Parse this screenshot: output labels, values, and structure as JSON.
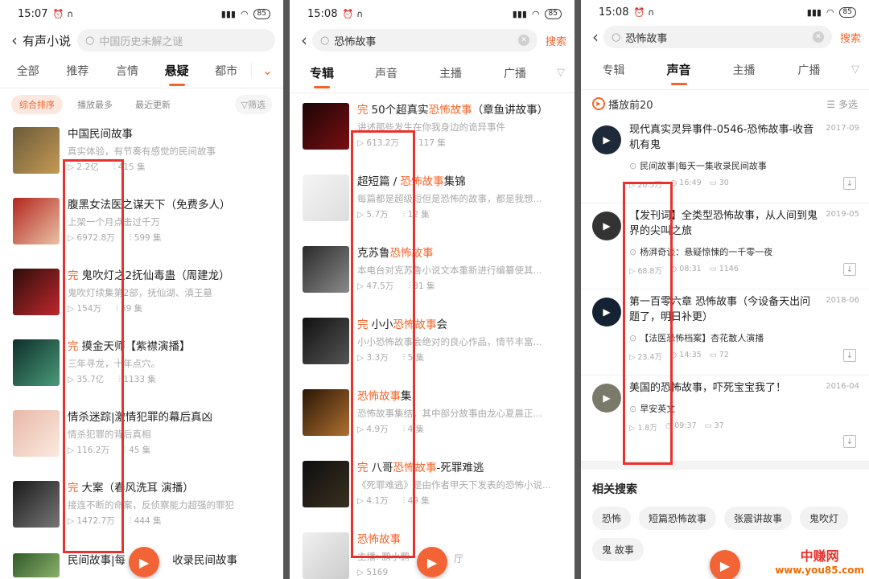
{
  "panel1": {
    "status": {
      "time": "15:07",
      "battery": "85"
    },
    "back_label": "‹",
    "title": "有声小说",
    "search_placeholder": "中国历史未解之谜",
    "tabs": [
      "全部",
      "推荐",
      "言情",
      "悬疑",
      "都市"
    ],
    "active_tab": "悬疑",
    "sort": [
      "综合排序",
      "播放最多",
      "最近更新"
    ],
    "filter": "筛选",
    "items": [
      {
        "done": "",
        "title": "中国民间故事",
        "desc": "真实体验，有节奏有感觉的民间故事",
        "plays": "2.2亿",
        "eps": "415 集",
        "c1": "#6b5a3a",
        "c2": "#c49a54"
      },
      {
        "done": "",
        "title": "腹黑女法医之谋天下（免费多人）",
        "desc": "上架一个月点击过千万",
        "plays": "6972.8万",
        "eps": "599 集",
        "c1": "#b3261e",
        "c2": "#e9c2a6"
      },
      {
        "done": "完",
        "title": "鬼吹灯之2抚仙毒蛊（周建龙）",
        "desc": "鬼吹灯续集第2部，抚仙湖、滇王墓",
        "plays": "154万",
        "eps": "59 集",
        "c1": "#2b0e0a",
        "c2": "#c1272d"
      },
      {
        "done": "完",
        "title": "摸金天师【紫襟演播】",
        "desc": "三年寻龙，十年点穴。",
        "plays": "35.7亿",
        "eps": "1133 集",
        "c1": "#0e2f2a",
        "c2": "#4a9a7a"
      },
      {
        "done": "",
        "title": "情杀迷踪|激情犯罪的幕后真凶",
        "desc": "情杀犯罪的背后真相",
        "plays": "116.2万",
        "eps": "45 集",
        "c1": "#e8b9a8",
        "c2": "#fbe9e0"
      },
      {
        "done": "完",
        "title": "大案（春风洗耳 演播）",
        "desc": "接连不断的命案，反侦察能力超强的罪犯",
        "plays": "1472.7万",
        "eps": "444 集",
        "c1": "#1a1a1a",
        "c2": "#777"
      }
    ],
    "last_title": "民间故事|每",
    "last_title2": "收录民间故事"
  },
  "panel2": {
    "status": {
      "time": "15:08",
      "battery": "85"
    },
    "query": "恐怖故事",
    "search_btn": "搜索",
    "tabs": [
      "专辑",
      "声音",
      "主播",
      "广播"
    ],
    "active_tab": "专辑",
    "items": [
      {
        "done": "完",
        "pre": "50个超真实",
        "hl": "恐怖故事",
        "post": "（章鱼讲故事）",
        "desc": "讲述那些发生在你我身边的诡异事件",
        "plays": "613.2万",
        "eps": "117 集",
        "c1": "#1c0505",
        "c2": "#7a0e12"
      },
      {
        "done": "",
        "pre": "超短篇 / ",
        "hl": "恐怖故事",
        "post": "集锦",
        "desc": "每篇都是超级短但是恐怖的故事，都是我想...",
        "plays": "5.7万",
        "eps": "12 集",
        "c1": "#f5f5f5",
        "c2": "#ddd"
      },
      {
        "done": "",
        "pre": "克苏鲁",
        "hl": "恐怖故事",
        "post": "",
        "desc": "本电台对克苏鲁小说文本重新进行编纂使其...",
        "plays": "47.5万",
        "eps": "31 集",
        "c1": "#2a2a2a",
        "c2": "#8a8a8a"
      },
      {
        "done": "完",
        "pre": "小小",
        "hl": "恐怖故事",
        "post": "会",
        "desc": "小小恐怖故事会绝对的良心作品，情节丰富...",
        "plays": "3.3万",
        "eps": "5 集",
        "c1": "#111",
        "c2": "#555"
      },
      {
        "done": "",
        "pre": "",
        "hl": "恐怖故事",
        "post": "集",
        "desc": "恐怖故事集结，其中部分故事由龙心夏晨正...",
        "plays": "4.9万",
        "eps": "4 集",
        "c1": "#2a1606",
        "c2": "#b07030"
      },
      {
        "done": "完",
        "pre": "八哥",
        "hl": "恐怖故事",
        "post": "-死罪难逃",
        "desc": "《死罪难逃》是由作者甲天下发表的恐怖小说...",
        "plays": "4.1万",
        "eps": "49 集",
        "c1": "#0e0e0e",
        "c2": "#3a3020"
      },
      {
        "done": "",
        "pre": "",
        "hl": "恐怖故事",
        "post": "",
        "desc": "主播: 鹏小鹏",
        "plays": "5169",
        "eps": "",
        "c1": "#f0f0f0",
        "c2": "#ccc"
      }
    ],
    "extra": "厅"
  },
  "panel3": {
    "status": {
      "time": "15:08",
      "battery": "85"
    },
    "query": "恐怖故事",
    "search_btn": "搜索",
    "tabs": [
      "专辑",
      "声音",
      "主播",
      "广播"
    ],
    "active_tab": "声音",
    "section": "播放前20",
    "multi": "多选",
    "items": [
      {
        "title": "现代真实灵异事件-0546-恐怖故事-收音机有鬼",
        "date": "2017-09",
        "host": "民间故事|每天一集收录民间故事",
        "plays": "20.5万",
        "dur": "16:49",
        "cmt": "30",
        "avbg": "#1e2a3a"
      },
      {
        "title": "【发刊词】全类型恐怖故事，从人间到鬼界的尖叫之旅",
        "date": "2019-05",
        "host": "杨湃奇谈：悬疑惊悚的一千零一夜",
        "plays": "68.8万",
        "dur": "08:31",
        "cmt": "1146",
        "avbg": "#333"
      },
      {
        "title": "第一百零六章 恐怖故事（今设备天出问题了，明日补更）",
        "date": "2018-06",
        "host": "【法医恐怖档案】杏花散人演播",
        "plays": "23.4万",
        "dur": "14:35",
        "cmt": "72",
        "avbg": "#152233"
      },
      {
        "title": "美国的恐怖故事，吓死宝宝我了！",
        "date": "2016-04",
        "host": "早安英文",
        "plays": "1.8万",
        "dur": "09:37",
        "cmt": "37",
        "avbg": "#7a7a6a"
      }
    ],
    "related_title": "相关搜索",
    "related": [
      "恐怖",
      "短篇恐怖故事",
      "张震讲故事",
      "鬼吹灯",
      "鬼 故事"
    ]
  },
  "watermark": {
    "line1": "中赚网",
    "line2": "www.you85.com"
  },
  "colors": {
    "accent": "#f5642a",
    "highlight_box": "#e8322d"
  }
}
